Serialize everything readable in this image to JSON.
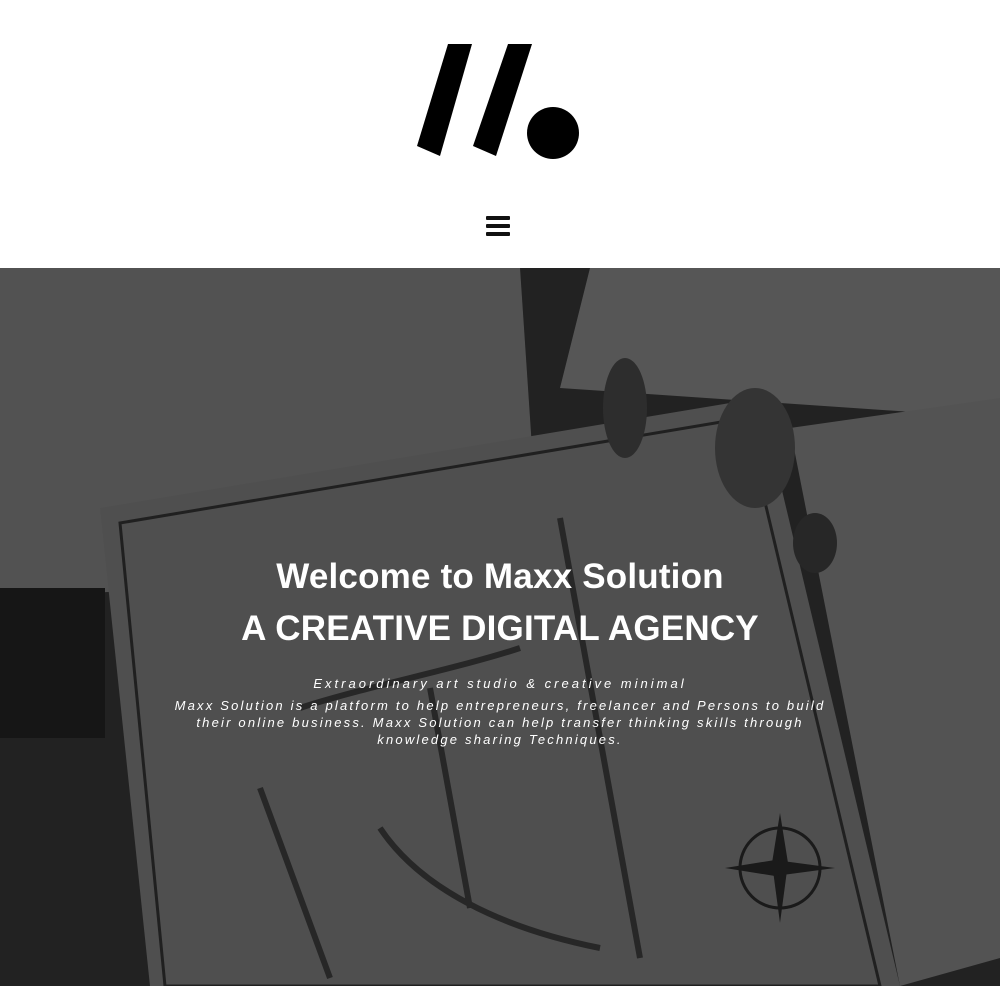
{
  "header": {
    "logo": "maxx-solution-logo",
    "menu_icon": "hamburger-icon"
  },
  "hero": {
    "title_line1": "Welcome to Maxx Solution",
    "title_line2": "A CREATIVE DIGITAL AGENCY",
    "tagline": "Extraordinary art studio & creative minimal",
    "description": "Maxx Solution is a platform to help entrepreneurs, freelancer and Persons to build their online business. Maxx Solution can help transfer thinking skills through knowledge sharing Techniques.",
    "background": "wedding-invitation-map-photo",
    "overlay_color": "#000000",
    "text_color": "#ffffff"
  }
}
